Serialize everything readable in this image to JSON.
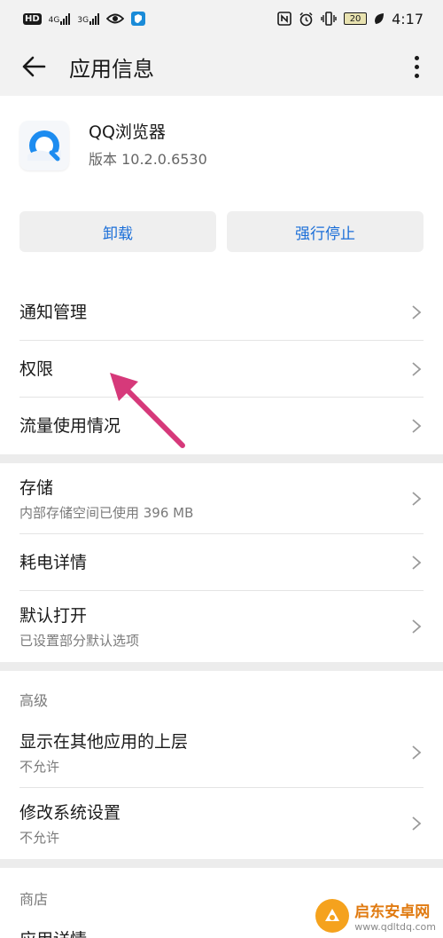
{
  "status_bar": {
    "left_icons": [
      "hd-icon",
      "signal-4g-icon",
      "signal-3g-icon",
      "eye-icon",
      "shield-app-icon"
    ],
    "sig1_label": "4G",
    "sig2_label": "3G",
    "hd_label": "HD",
    "right_icons": [
      "nfc-icon",
      "alarm-icon",
      "vibrate-icon",
      "battery-icon",
      "leaf-icon"
    ],
    "battery_level": "20",
    "time": "4:17"
  },
  "app_bar": {
    "title": "应用信息"
  },
  "app": {
    "name": "QQ浏览器",
    "version": "版本 10.2.0.6530"
  },
  "buttons": {
    "uninstall": "卸载",
    "force_stop": "强行停止"
  },
  "section1": [
    {
      "title": "通知管理"
    },
    {
      "title": "权限"
    },
    {
      "title": "流量使用情况"
    }
  ],
  "section2": [
    {
      "title": "存储",
      "sub": "内部存储空间已使用 396 MB"
    },
    {
      "title": "耗电详情"
    },
    {
      "title": "默认打开",
      "sub": "已设置部分默认选项"
    }
  ],
  "advanced": {
    "label": "高级",
    "items": [
      {
        "title": "显示在其他应用的上层",
        "sub": "不允许"
      },
      {
        "title": "修改系统设置",
        "sub": "不允许"
      }
    ]
  },
  "store": {
    "label": "商店",
    "partial_item": "应用详情"
  },
  "watermark": {
    "name": "启东安卓网",
    "url": "www.qdltdq.com"
  },
  "colors": {
    "accent": "#1a6ed8",
    "arrow": "#d6397a",
    "background": "#ffffff",
    "header_bg": "#f2f2f2"
  }
}
